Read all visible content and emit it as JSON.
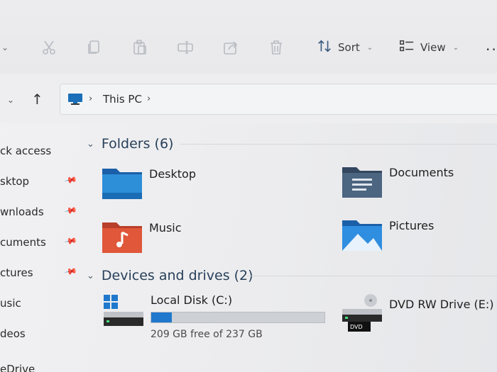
{
  "toolbar": {
    "sort_label": "Sort",
    "view_label": "View",
    "more_label": "..."
  },
  "address": {
    "crumb": "This PC"
  },
  "sidebar": {
    "items": [
      {
        "label": "ck access"
      },
      {
        "label": "sktop"
      },
      {
        "label": "wnloads"
      },
      {
        "label": "cuments"
      },
      {
        "label": "ctures"
      },
      {
        "label": "usic"
      },
      {
        "label": "deos"
      },
      {
        "label": "eDrive"
      }
    ]
  },
  "folders": {
    "heading": "Folders (6)",
    "items": [
      {
        "name": "Desktop"
      },
      {
        "name": "Documents"
      },
      {
        "name": "Music"
      },
      {
        "name": "Pictures"
      }
    ]
  },
  "drives": {
    "heading": "Devices and drives (2)",
    "items": [
      {
        "name": "Local Disk (C:)",
        "free_text": "209 GB free of 237 GB",
        "used_fraction": 0.118
      },
      {
        "name": "DVD RW Drive (E:)",
        "badge": "DVD"
      }
    ]
  },
  "colors": {
    "accent": "#1f78cd",
    "heading": "#28405a"
  }
}
